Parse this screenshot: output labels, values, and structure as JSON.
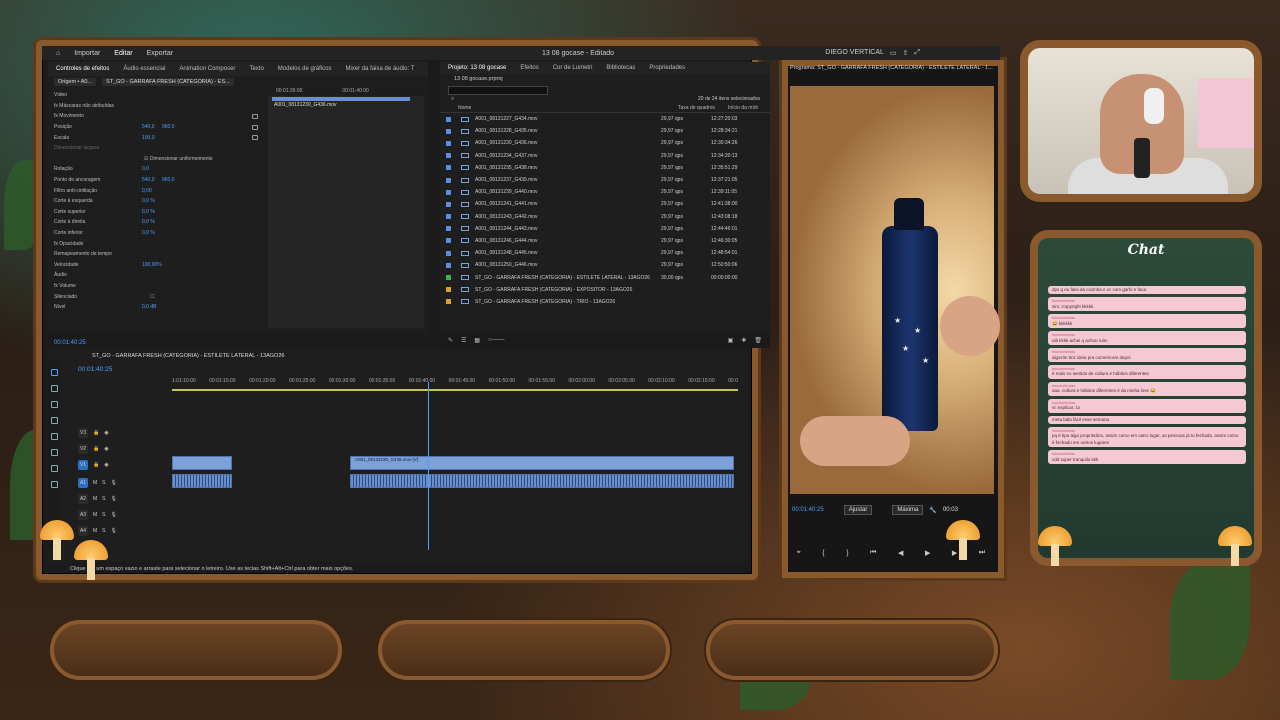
{
  "app": {
    "menu": [
      "Importar",
      "Editar",
      "Exportar"
    ],
    "project_title": "13 08 gocase - Editado",
    "workspace": "DIEGO VERTICAL"
  },
  "source_panel": {
    "tabs": [
      "Controles de efeitos",
      "Áudio essencial",
      "Animation Composer",
      "Texto",
      "Modelos de gráficos",
      "Mixer da faixa de áudio: T"
    ],
    "clip_tabs": [
      "Origem • A0...",
      "ST_GO - GARRAFA FRESH (CATEGORIA) - ES..."
    ],
    "clip_name": "A001_08131230_G436.mov",
    "ruler": [
      "00:01:39:00",
      "00:01:40:00"
    ],
    "rows": [
      {
        "label": "Vídeo"
      },
      {
        "label": "fx Máscaras não atribuídas"
      },
      {
        "label": "fx Movimento"
      },
      {
        "label": "Posição",
        "v1": "540,0",
        "v2": "960,0"
      },
      {
        "label": "Escala",
        "v1": "100,0"
      },
      {
        "label": "Dimensionar largura"
      },
      {
        "label": "Dimensionar uniformemente"
      },
      {
        "label": "Rotação",
        "v1": "0,0"
      },
      {
        "label": "Ponto de ancoragem",
        "v1": "540,0",
        "v2": "960,0"
      },
      {
        "label": "Filtro anti-cintilação",
        "v1": "0,00"
      },
      {
        "label": "Corte à esquerda",
        "v1": "0,0 %"
      },
      {
        "label": "Corte superior",
        "v1": "0,0 %"
      },
      {
        "label": "Corte à direita",
        "v1": "0,0 %"
      },
      {
        "label": "Corte inferior",
        "v1": "0,0 %"
      },
      {
        "label": "fx Opacidade"
      },
      {
        "label": "Remapeamento de tempo"
      },
      {
        "label": "Velocidade",
        "v1": "100,00%"
      },
      {
        "label": "Áudio"
      },
      {
        "label": "fx Volume"
      },
      {
        "label": "Silenciado"
      },
      {
        "label": "Nível",
        "v1": "0,0 dB"
      }
    ],
    "reset_label": "Apagar tudo",
    "timecode": "00:01:40:25"
  },
  "project_panel": {
    "tabs": [
      "Projeto: 13 08 gocase",
      "Efeitos",
      "Cor de Lumetri",
      "Bibliotecas",
      "Propriedades"
    ],
    "project_file": "13 08 gocase.prproj",
    "selected_count": "20 de 24 itens selecionados",
    "columns": [
      "Nome",
      "Taxa de quadros",
      "Início da mídi"
    ],
    "items": [
      {
        "name": "A001_08131227_G434.mov",
        "fps": "29,97 qps",
        "start": "12:27:20:03",
        "kind": "clip"
      },
      {
        "name": "A001_08131228_G435.mov",
        "fps": "29,97 qps",
        "start": "12:28:34:21",
        "kind": "clip"
      },
      {
        "name": "A001_08131230_G436.mov",
        "fps": "29,97 qps",
        "start": "12:30:34:26",
        "kind": "clip"
      },
      {
        "name": "A001_08131234_G437.mov",
        "fps": "29,97 qps",
        "start": "12:34:20:13",
        "kind": "clip"
      },
      {
        "name": "A001_08131235_G438.mov",
        "fps": "29,97 qps",
        "start": "12:35:51:29",
        "kind": "clip"
      },
      {
        "name": "A001_08131237_G439.mov",
        "fps": "29,97 qps",
        "start": "12:37:21:05",
        "kind": "clip"
      },
      {
        "name": "A001_08131239_G440.mov",
        "fps": "29,97 qps",
        "start": "12:39:11:05",
        "kind": "clip"
      },
      {
        "name": "A001_08131241_G441.mov",
        "fps": "29,97 qps",
        "start": "12:41:38:00",
        "kind": "clip"
      },
      {
        "name": "A001_08131243_G442.mov",
        "fps": "29,97 qps",
        "start": "12:43:08:18",
        "kind": "clip"
      },
      {
        "name": "A001_08131244_G443.mov",
        "fps": "29,97 qps",
        "start": "12:44:46:01",
        "kind": "clip"
      },
      {
        "name": "A001_08131246_G444.mov",
        "fps": "29,97 qps",
        "start": "12:46:30:05",
        "kind": "clip"
      },
      {
        "name": "A001_08131248_G445.mov",
        "fps": "29,97 qps",
        "start": "12:48:54:01",
        "kind": "clip"
      },
      {
        "name": "A001_08131250_G446.mov",
        "fps": "29,97 qps",
        "start": "12:50:50:06",
        "kind": "clip"
      },
      {
        "name": "ST_GO - GARRAFA FRESH (CATEGORIA) - ESTILETE LATERAL - 13AGO26",
        "fps": "30,00 qps",
        "start": "00:00:00:00",
        "kind": "seq"
      },
      {
        "name": "ST_GO - GARRAFA FRESH (CATEGORIA) - EXPOSITOR - 13AGO26",
        "fps": "",
        "start": "",
        "kind": "bin"
      },
      {
        "name": "ST_GO - GARRAFA FRESH (CATEGORIA) - TRIO - 13AGO26",
        "fps": "",
        "start": "",
        "kind": "bin"
      }
    ]
  },
  "timeline": {
    "sequence": "ST_GO - GARRAFA FRESH (CATEGORIA) - ESTILETE LATERAL - 13AGO26",
    "timecode": "00:01:40:25",
    "ruler": [
      "1:01:10:00",
      "00:01:15:00",
      "00:01:20:00",
      "00:01:25:00",
      "00:01:30:00",
      "00:01:35:00",
      "00:01:40:00",
      "00:01:45:00",
      "00:01:50:00",
      "00:01:55:00",
      "00:02:00:00",
      "00:02:05:00",
      "00:02:10:00",
      "00:02:15:00",
      "00:0"
    ],
    "tracks": [
      "V3",
      "V2",
      "V1",
      "A1",
      "A2",
      "A3",
      "A4"
    ],
    "clip_label": "A001_08131230_G436.mov [V]",
    "status": "Clique em um espaço vazio e arraste para selecionar o letreiro. Use as teclas Shift+Alt+Ctrl para obter mais opções."
  },
  "program_monitor": {
    "title": "Programa: ST_GO - GARRAFA FRESH (CATEGORIA) - ESTILETE LATERAL - 1...",
    "timecode": "00:01:40:25",
    "fit": "Ajustar",
    "quality": "Máxima",
    "tc_right": "00:03"
  },
  "chat": {
    "title": "Chat",
    "messages": [
      {
        "user": "",
        "text": "dps q eu falei da cozinha e vc com garfo e faca"
      },
      {
        "user": "twucketestas",
        "text": "sim, Copyright kkkkk"
      },
      {
        "user": "twucketestas",
        "text": "😂 kkkkkk"
      },
      {
        "user": "twucketestas",
        "text": "ulá kkkk achei q achou ruim"
      },
      {
        "user": "twucketestas",
        "text": "algozim tinz ideia pra comemorar depoi"
      },
      {
        "user": "twucketestas",
        "text": "é mais no sentido de cultura e hábitos diferentes"
      },
      {
        "user": "twucketestas",
        "text": "aaa, cultura e hábitos diferentes é da minha love 😂"
      },
      {
        "user": "twucketestas",
        "text": "vc explicar, 1x"
      },
      {
        "user": "",
        "text": "meta bala fácil esse semana"
      },
      {
        "user": "twucketestas",
        "text": "pq é tipo algo proprietário, assim como em outro lugar, as pessoas já tu fechada, assim como é fechado em outros lugares"
      },
      {
        "user": "twucketestas",
        "text": "vdd super tranquilo kkk"
      }
    ]
  },
  "colors": {
    "accent_blue": "#4aa0ff",
    "clip_blue": "#7ca0d8",
    "sequence_green": "#39b54a",
    "bin_orange": "#e0a030",
    "frame_wood": "#8a5a2e",
    "chat_pink": "#f4c9d3"
  }
}
